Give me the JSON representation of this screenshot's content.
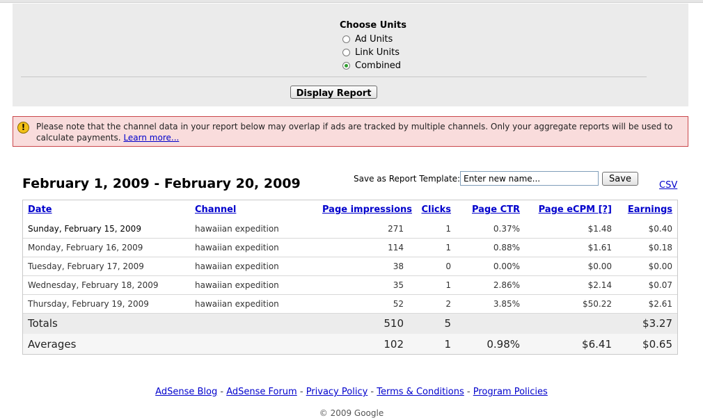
{
  "units_panel": {
    "title": "Choose Units",
    "options": [
      {
        "label": "Ad Units",
        "selected": false
      },
      {
        "label": "Link Units",
        "selected": false
      },
      {
        "label": "Combined",
        "selected": true
      }
    ],
    "display_button": "Display Report"
  },
  "notice": {
    "icon": "exclamation-icon",
    "text": "Please note that the channel data in your report below may overlap if ads are tracked by multiple channels. Only your aggregate reports will be used to calculate payments.",
    "link": "Learn more..."
  },
  "report": {
    "date_range": "February 1, 2009 - February 20, 2009",
    "template_label": "Save as Report Template:",
    "template_placeholder": "Enter new name...",
    "save_label": "Save",
    "csv_label": "CSV",
    "columns": [
      "Date",
      "Channel",
      "Page impressions",
      "Clicks",
      "Page CTR",
      "Page eCPM [?]",
      "Earnings"
    ],
    "rows": [
      {
        "date": "Sunday, February 15, 2009",
        "channel": "hawaiian expedition",
        "impressions": "271",
        "clicks": "1",
        "ctr": "0.37%",
        "ecpm": "$1.48",
        "earnings": "$0.40"
      },
      {
        "date": "Monday, February 16, 2009",
        "channel": "hawaiian expedition",
        "impressions": "114",
        "clicks": "1",
        "ctr": "0.88%",
        "ecpm": "$1.61",
        "earnings": "$0.18"
      },
      {
        "date": "Tuesday, February 17, 2009",
        "channel": "hawaiian expedition",
        "impressions": "38",
        "clicks": "0",
        "ctr": "0.00%",
        "ecpm": "$0.00",
        "earnings": "$0.00"
      },
      {
        "date": "Wednesday, February 18, 2009",
        "channel": "hawaiian expedition",
        "impressions": "35",
        "clicks": "1",
        "ctr": "2.86%",
        "ecpm": "$2.14",
        "earnings": "$0.07"
      },
      {
        "date": "Thursday, February 19, 2009",
        "channel": "hawaiian expedition",
        "impressions": "52",
        "clicks": "2",
        "ctr": "3.85%",
        "ecpm": "$50.22",
        "earnings": "$2.61"
      }
    ],
    "totals": {
      "label": "Totals",
      "impressions": "510",
      "clicks": "5",
      "earnings": "$3.27"
    },
    "averages": {
      "label": "Averages",
      "impressions": "102",
      "clicks": "1",
      "ctr": "0.98%",
      "ecpm": "$6.41",
      "earnings": "$0.65"
    }
  },
  "footer": {
    "links": [
      "AdSense Blog",
      "AdSense Forum",
      "Privacy Policy",
      "Terms & Conditions",
      "Program Policies"
    ],
    "separator": " - ",
    "copyright": "© 2009 Google"
  }
}
